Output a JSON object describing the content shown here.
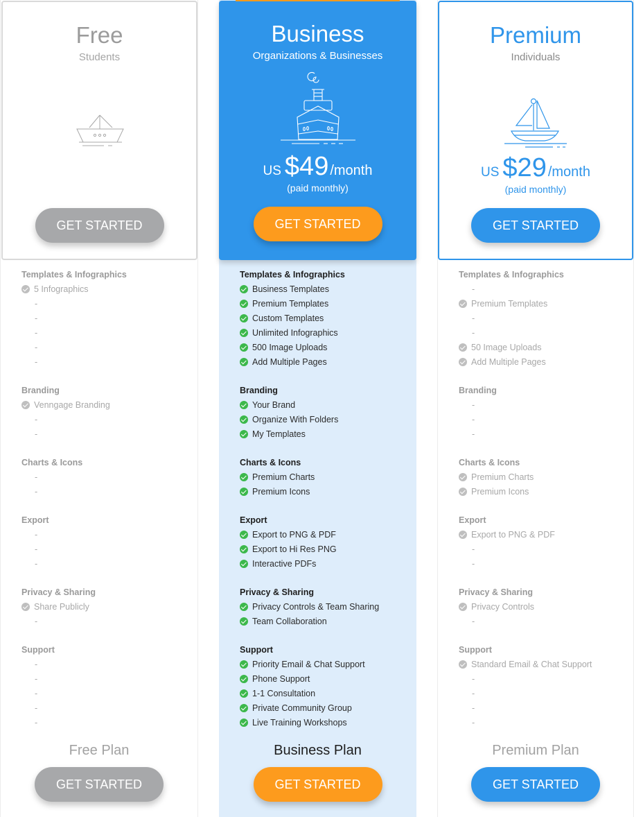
{
  "colors": {
    "accent_blue": "#2f95ea",
    "accent_orange": "#fd9b1d",
    "button_gray": "#a7a8aa",
    "check_green": "#3cb84b",
    "check_gray": "#bfbfbf",
    "business_column_bg": "#deedfb"
  },
  "plans": [
    {
      "id": "free",
      "name": "Free",
      "audience": "Students",
      "icon": "paper-boat-icon",
      "price": null,
      "cta_label": "GET STARTED",
      "footer_name": "Free Plan",
      "footer_cta_label": "GET STARTED",
      "sections": [
        {
          "title": "Templates & Infographics",
          "items": [
            {
              "included": true,
              "label": "5 Infographics"
            },
            {
              "included": false,
              "label": "-"
            },
            {
              "included": false,
              "label": "-"
            },
            {
              "included": false,
              "label": "-"
            },
            {
              "included": false,
              "label": "-"
            },
            {
              "included": false,
              "label": "-"
            }
          ]
        },
        {
          "title": "Branding",
          "items": [
            {
              "included": true,
              "label": "Venngage Branding"
            },
            {
              "included": false,
              "label": "-"
            },
            {
              "included": false,
              "label": "-"
            }
          ]
        },
        {
          "title": "Charts & Icons",
          "items": [
            {
              "included": false,
              "label": "-"
            },
            {
              "included": false,
              "label": "-"
            }
          ]
        },
        {
          "title": "Export",
          "items": [
            {
              "included": false,
              "label": "-"
            },
            {
              "included": false,
              "label": "-"
            },
            {
              "included": false,
              "label": "-"
            }
          ]
        },
        {
          "title": "Privacy & Sharing",
          "items": [
            {
              "included": true,
              "label": "Share Publicly"
            },
            {
              "included": false,
              "label": "-"
            }
          ]
        },
        {
          "title": "Support",
          "items": [
            {
              "included": false,
              "label": "-"
            },
            {
              "included": false,
              "label": "-"
            },
            {
              "included": false,
              "label": "-"
            },
            {
              "included": false,
              "label": "-"
            },
            {
              "included": false,
              "label": "-"
            }
          ]
        }
      ]
    },
    {
      "id": "business",
      "name": "Business",
      "audience": "Organizations & Businesses",
      "icon": "steamship-icon",
      "price": {
        "currency": "US",
        "amount": "$49",
        "period": "/month",
        "billing": "(paid monthly)"
      },
      "cta_label": "GET STARTED",
      "footer_name": "Business Plan",
      "footer_cta_label": "GET STARTED",
      "sections": [
        {
          "title": "Templates & Infographics",
          "items": [
            {
              "included": true,
              "label": "Business Templates"
            },
            {
              "included": true,
              "label": "Premium Templates"
            },
            {
              "included": true,
              "label": "Custom Templates"
            },
            {
              "included": true,
              "label": "Unlimited Infographics"
            },
            {
              "included": true,
              "label": "500 Image Uploads"
            },
            {
              "included": true,
              "label": "Add Multiple Pages"
            }
          ]
        },
        {
          "title": "Branding",
          "items": [
            {
              "included": true,
              "label": "Your Brand"
            },
            {
              "included": true,
              "label": "Organize With Folders"
            },
            {
              "included": true,
              "label": "My Templates"
            }
          ]
        },
        {
          "title": "Charts & Icons",
          "items": [
            {
              "included": true,
              "label": "Premium Charts"
            },
            {
              "included": true,
              "label": "Premium Icons"
            }
          ]
        },
        {
          "title": "Export",
          "items": [
            {
              "included": true,
              "label": "Export to PNG & PDF"
            },
            {
              "included": true,
              "label": "Export to Hi Res PNG"
            },
            {
              "included": true,
              "label": "Interactive PDFs"
            }
          ]
        },
        {
          "title": "Privacy & Sharing",
          "items": [
            {
              "included": true,
              "label": "Privacy Controls & Team Sharing"
            },
            {
              "included": true,
              "label": "Team Collaboration"
            }
          ]
        },
        {
          "title": "Support",
          "items": [
            {
              "included": true,
              "label": "Priority Email & Chat Support"
            },
            {
              "included": true,
              "label": "Phone Support"
            },
            {
              "included": true,
              "label": "1-1 Consultation"
            },
            {
              "included": true,
              "label": "Private Community Group"
            },
            {
              "included": true,
              "label": "Live Training Workshops"
            }
          ]
        }
      ]
    },
    {
      "id": "premium",
      "name": "Premium",
      "audience": "Individuals",
      "icon": "sailboat-icon",
      "price": {
        "currency": "US",
        "amount": "$29",
        "period": "/month",
        "billing": "(paid monthly)"
      },
      "cta_label": "GET STARTED",
      "footer_name": "Premium Plan",
      "footer_cta_label": "GET STARTED",
      "sections": [
        {
          "title": "Templates & Infographics",
          "items": [
            {
              "included": false,
              "label": "-"
            },
            {
              "included": true,
              "label": "Premium Templates"
            },
            {
              "included": false,
              "label": "-"
            },
            {
              "included": false,
              "label": "-"
            },
            {
              "included": true,
              "label": "50 Image Uploads"
            },
            {
              "included": true,
              "label": "Add Multiple Pages"
            }
          ]
        },
        {
          "title": "Branding",
          "items": [
            {
              "included": false,
              "label": "-"
            },
            {
              "included": false,
              "label": "-"
            },
            {
              "included": false,
              "label": "-"
            }
          ]
        },
        {
          "title": "Charts & Icons",
          "items": [
            {
              "included": true,
              "label": "Premium Charts"
            },
            {
              "included": true,
              "label": "Premium Icons"
            }
          ]
        },
        {
          "title": "Export",
          "items": [
            {
              "included": true,
              "label": "Export to PNG & PDF"
            },
            {
              "included": false,
              "label": "-"
            },
            {
              "included": false,
              "label": "-"
            }
          ]
        },
        {
          "title": "Privacy & Sharing",
          "items": [
            {
              "included": true,
              "label": "Privacy Controls"
            },
            {
              "included": false,
              "label": "-"
            }
          ]
        },
        {
          "title": "Support",
          "items": [
            {
              "included": true,
              "label": "Standard Email & Chat Support"
            },
            {
              "included": false,
              "label": "-"
            },
            {
              "included": false,
              "label": "-"
            },
            {
              "included": false,
              "label": "-"
            },
            {
              "included": false,
              "label": "-"
            }
          ]
        }
      ]
    }
  ]
}
